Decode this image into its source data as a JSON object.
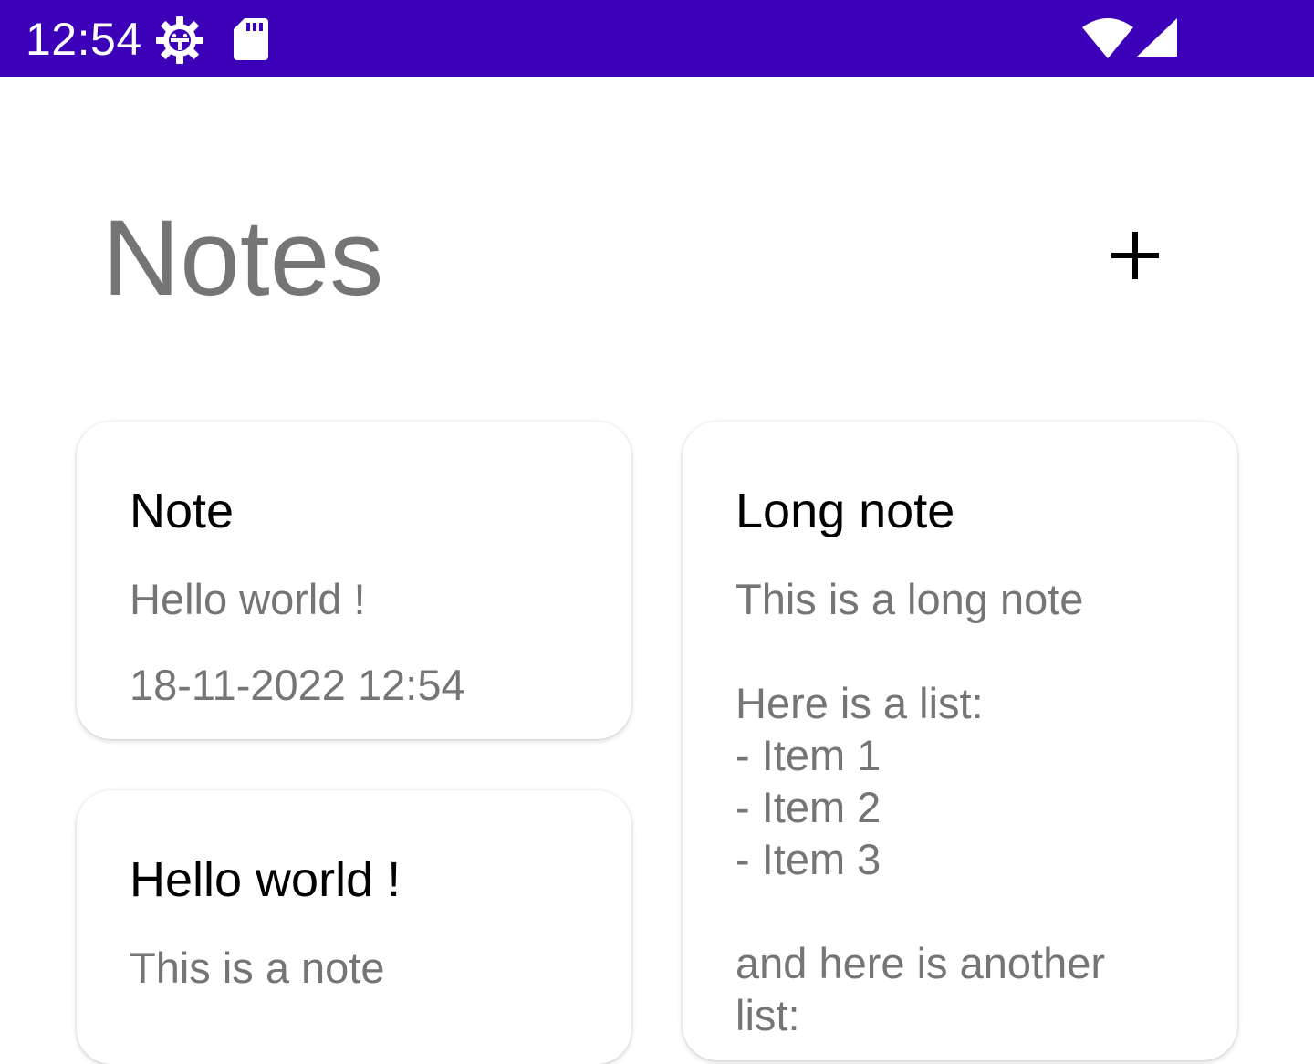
{
  "status_bar": {
    "time": "12:54",
    "background_color": "#3c00b8",
    "left_icons": [
      "settings-gear-icon",
      "sd-card-icon"
    ],
    "right_icons": [
      "wifi-icon",
      "cell-signal-icon"
    ]
  },
  "header": {
    "title": "Notes",
    "add_icon": "plus-icon"
  },
  "notes": [
    {
      "title": "Note",
      "body": "Hello world !",
      "date": "18-11-2022 12:54"
    },
    {
      "title": "Long note",
      "body": "This is a long note\n\nHere is a list:\n- Item 1\n- Item 2\n- Item 3\n\nand here is another\nlist:"
    },
    {
      "title": "Hello world !",
      "body": "This is a note"
    }
  ]
}
